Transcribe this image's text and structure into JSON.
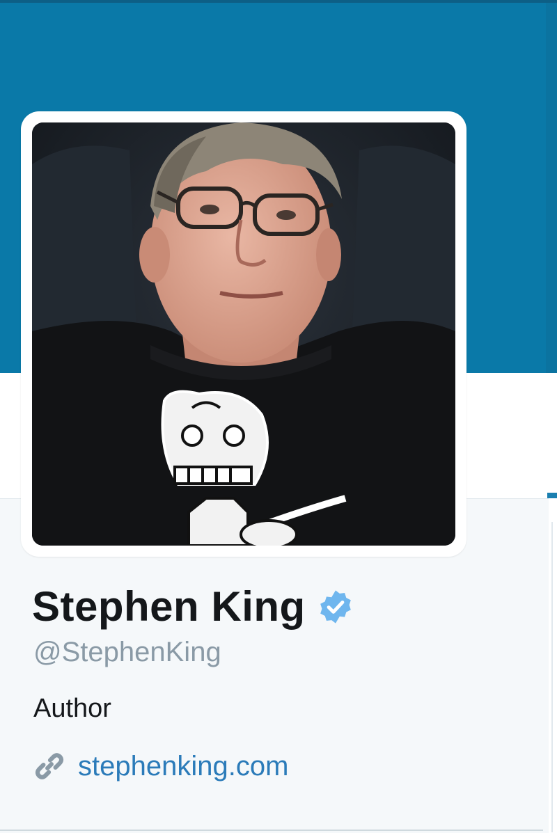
{
  "profile": {
    "name": "Stephen King",
    "handle": "@StephenKing",
    "bio": "Author",
    "url": "stephenking.com",
    "verified": true
  },
  "icons": {
    "verified": "verified-badge-icon",
    "link": "link-icon"
  },
  "colors": {
    "banner": "#0a79a8",
    "link": "#2b7bb9",
    "verified": "#1da1f2",
    "handle": "#8a9aa6"
  }
}
